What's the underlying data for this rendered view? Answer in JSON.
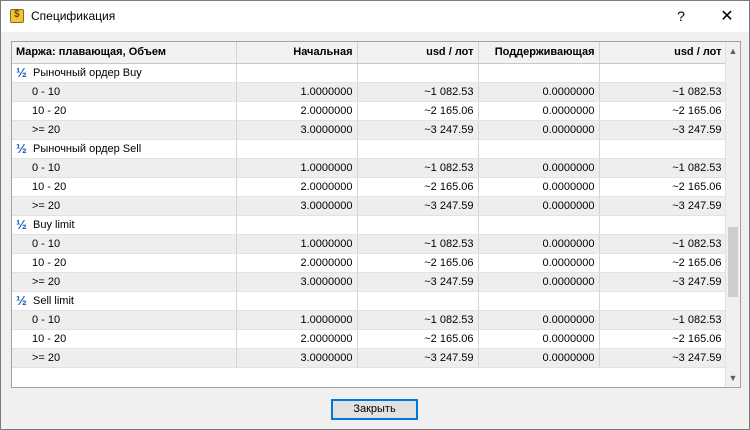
{
  "window": {
    "title": "Спецификация",
    "help_label": "?",
    "close_label": "✕"
  },
  "table": {
    "columns": [
      "Маржа: плавающая, Объем",
      "Начальная",
      "usd / лот",
      "Поддерживающая",
      "usd / лот"
    ],
    "groups": [
      {
        "name": "Рыночный ордер Buy",
        "rows": [
          [
            "0 - 10",
            "1.0000000",
            "~1 082.53",
            "0.0000000",
            "~1 082.53"
          ],
          [
            "10 - 20",
            "2.0000000",
            "~2 165.06",
            "0.0000000",
            "~2 165.06"
          ],
          [
            ">= 20",
            "3.0000000",
            "~3 247.59",
            "0.0000000",
            "~3 247.59"
          ]
        ]
      },
      {
        "name": "Рыночный ордер Sell",
        "rows": [
          [
            "0 - 10",
            "1.0000000",
            "~1 082.53",
            "0.0000000",
            "~1 082.53"
          ],
          [
            "10 - 20",
            "2.0000000",
            "~2 165.06",
            "0.0000000",
            "~2 165.06"
          ],
          [
            ">= 20",
            "3.0000000",
            "~3 247.59",
            "0.0000000",
            "~3 247.59"
          ]
        ]
      },
      {
        "name": "Buy limit",
        "rows": [
          [
            "0 - 10",
            "1.0000000",
            "~1 082.53",
            "0.0000000",
            "~1 082.53"
          ],
          [
            "10 - 20",
            "2.0000000",
            "~2 165.06",
            "0.0000000",
            "~2 165.06"
          ],
          [
            ">= 20",
            "3.0000000",
            "~3 247.59",
            "0.0000000",
            "~3 247.59"
          ]
        ]
      },
      {
        "name": "Sell limit",
        "rows": [
          [
            "0 - 10",
            "1.0000000",
            "~1 082.53",
            "0.0000000",
            "~1 082.53"
          ],
          [
            "10 - 20",
            "2.0000000",
            "~2 165.06",
            "0.0000000",
            "~2 165.06"
          ],
          [
            ">= 20",
            "3.0000000",
            "~3 247.59",
            "0.0000000",
            "~3 247.59"
          ]
        ]
      }
    ]
  },
  "icons": {
    "group_icon": "½",
    "app_icon": "dollar-app-icon",
    "scroll_up": "▲",
    "scroll_down": "▼"
  },
  "footer": {
    "close_button_label": "Закрыть"
  },
  "colors": {
    "accent": "#0078d7",
    "group_icon": "#1f5fb8",
    "row_alt": "#eeeeee"
  }
}
